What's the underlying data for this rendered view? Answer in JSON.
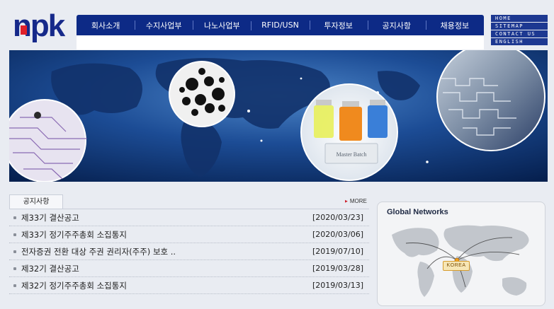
{
  "logo": {
    "text": "npk"
  },
  "nav": {
    "items": [
      "회사소개",
      "수지사업부",
      "나노사업부",
      "RFID/USN",
      "투자정보",
      "공지사항",
      "채용정보"
    ]
  },
  "util_nav": [
    "HOME",
    "SITEMAP",
    "CONTACT US",
    "ENGLISH"
  ],
  "banner": {
    "bottle_label": "Master Batch"
  },
  "notice": {
    "tab_label": "공지사항",
    "more_label": "MORE",
    "items": [
      {
        "title": "제33기 결산공고",
        "date": "[2020/03/23]"
      },
      {
        "title": "제33기 정기주주총회 소집통지",
        "date": "[2020/03/06]"
      },
      {
        "title": "전자증권 전환 대상 주권 권리자(주주) 보호 ..",
        "date": "[2019/07/10]"
      },
      {
        "title": "제32기 결산공고",
        "date": "[2019/03/28]"
      },
      {
        "title": "제32기 정기주주총회 소집통지",
        "date": "[2019/03/13]"
      }
    ]
  },
  "global_networks": {
    "title": "Global Networks",
    "korea_label": "KOREA"
  },
  "colors": {
    "brand_navy": "#0d2a86",
    "logo_red": "#e0202a",
    "link_orange": "#f0a020"
  }
}
